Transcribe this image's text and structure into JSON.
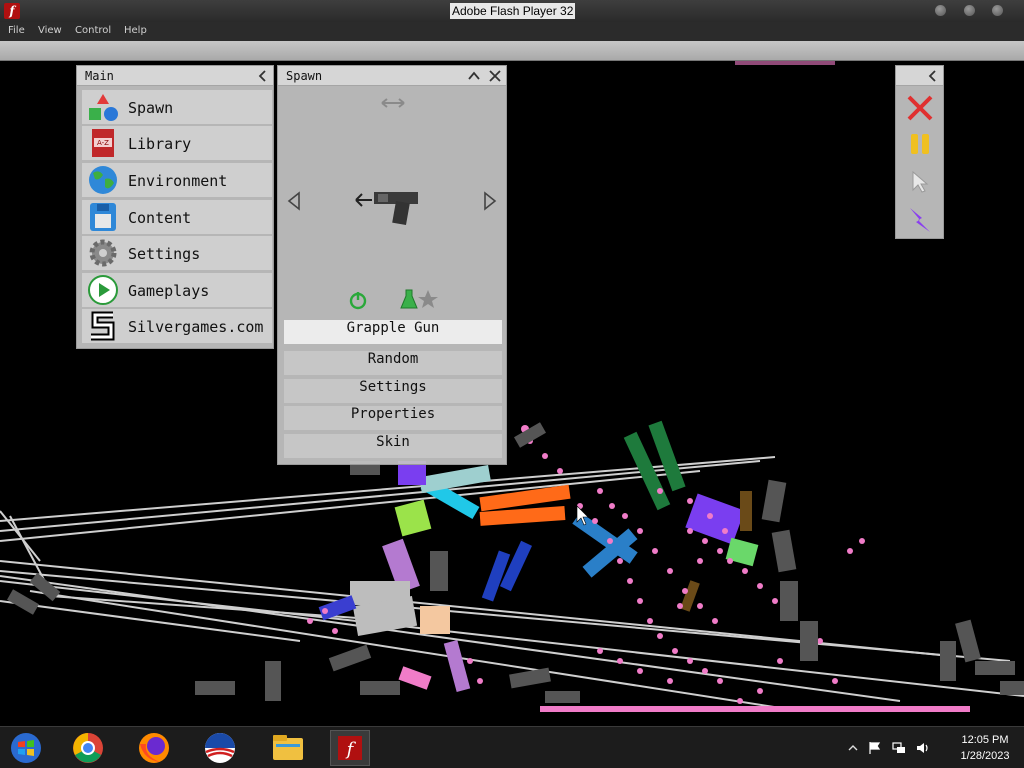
{
  "window": {
    "title": "Adobe Flash Player 32"
  },
  "menu": [
    "File",
    "View",
    "Control",
    "Help"
  ],
  "main_panel": {
    "title": "Main",
    "items": [
      {
        "label": "Spawn",
        "icon": "shapes-icon"
      },
      {
        "label": "Library",
        "icon": "book-icon"
      },
      {
        "label": "Environment",
        "icon": "globe-icon"
      },
      {
        "label": "Content",
        "icon": "floppy-disk-icon"
      },
      {
        "label": "Settings",
        "icon": "gear-icon"
      },
      {
        "label": "Gameplays",
        "icon": "play-icon"
      },
      {
        "label": "Silvergames.com",
        "icon": "silvergames-logo-icon"
      }
    ]
  },
  "spawn_panel": {
    "title": "Spawn",
    "selected_item": "Grapple Gun",
    "buttons": [
      "Random",
      "Settings",
      "Properties",
      "Skin"
    ]
  },
  "tools": [
    "close-x-icon",
    "pause-icon",
    "cursor-icon",
    "lightning-icon"
  ],
  "taskbar": {
    "apps": [
      "windows-start-icon",
      "chrome-icon",
      "firefox-icon",
      "obama-logo-icon",
      "file-explorer-icon",
      "flash-player-icon"
    ],
    "time": "12:05 PM",
    "date": "1/28/2023"
  },
  "colors": {
    "pink_particles": "#f07cc8",
    "panel_bg": "#c4c4c4",
    "flash_red": "#b01010"
  }
}
